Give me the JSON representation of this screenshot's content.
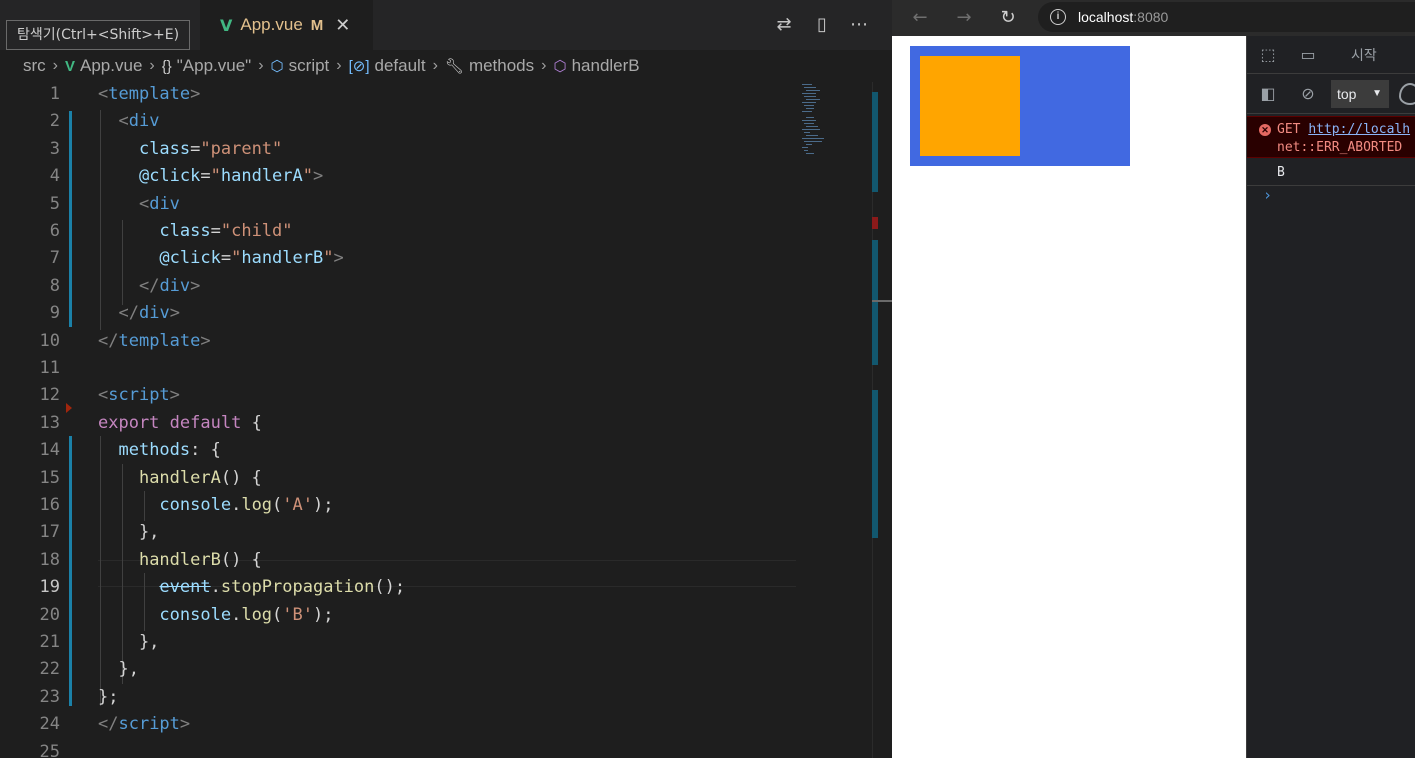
{
  "editor": {
    "tooltip": "탐색기(Ctrl+<Shift>+E)",
    "tab": {
      "filename": "App.vue",
      "modified": "M",
      "close": "✕"
    },
    "breadcrumb": [
      "src",
      "App.vue",
      "\"App.vue\"",
      "script",
      "default",
      "methods",
      "handlerB"
    ],
    "lines": [
      {
        "n": "1",
        "tokens": [
          [
            "t-punc",
            "<"
          ],
          [
            "t-tag",
            "template"
          ],
          [
            "t-punc",
            ">"
          ]
        ]
      },
      {
        "n": "2",
        "tokens": [
          [
            "t-plain",
            "  "
          ],
          [
            "t-punc",
            "<"
          ],
          [
            "t-tag",
            "div"
          ]
        ]
      },
      {
        "n": "3",
        "tokens": [
          [
            "t-plain",
            "    "
          ],
          [
            "t-attr",
            "class"
          ],
          [
            "t-plain",
            "="
          ],
          [
            "t-str",
            "\"parent\""
          ]
        ]
      },
      {
        "n": "4",
        "tokens": [
          [
            "t-plain",
            "    "
          ],
          [
            "t-attr",
            "@click"
          ],
          [
            "t-plain",
            "="
          ],
          [
            "t-str",
            "\""
          ],
          [
            "t-var",
            "handlerA"
          ],
          [
            "t-str",
            "\""
          ],
          [
            "t-punc",
            ">"
          ]
        ]
      },
      {
        "n": "5",
        "tokens": [
          [
            "t-plain",
            "    "
          ],
          [
            "t-punc",
            "<"
          ],
          [
            "t-tag",
            "div"
          ]
        ]
      },
      {
        "n": "6",
        "tokens": [
          [
            "t-plain",
            "      "
          ],
          [
            "t-attr",
            "class"
          ],
          [
            "t-plain",
            "="
          ],
          [
            "t-str",
            "\"child\""
          ]
        ]
      },
      {
        "n": "7",
        "tokens": [
          [
            "t-plain",
            "      "
          ],
          [
            "t-attr",
            "@click"
          ],
          [
            "t-plain",
            "="
          ],
          [
            "t-str",
            "\""
          ],
          [
            "t-var",
            "handlerB"
          ],
          [
            "t-str",
            "\""
          ],
          [
            "t-punc",
            ">"
          ]
        ]
      },
      {
        "n": "8",
        "tokens": [
          [
            "t-plain",
            "    "
          ],
          [
            "t-punc",
            "</"
          ],
          [
            "t-tag",
            "div"
          ],
          [
            "t-punc",
            ">"
          ]
        ]
      },
      {
        "n": "9",
        "tokens": [
          [
            "t-plain",
            "  "
          ],
          [
            "t-punc",
            "</"
          ],
          [
            "t-tag",
            "div"
          ],
          [
            "t-punc",
            ">"
          ]
        ]
      },
      {
        "n": "10",
        "tokens": [
          [
            "t-punc",
            "</"
          ],
          [
            "t-tag",
            "template"
          ],
          [
            "t-punc",
            ">"
          ]
        ]
      },
      {
        "n": "11",
        "tokens": []
      },
      {
        "n": "12",
        "tokens": [
          [
            "t-punc",
            "<"
          ],
          [
            "t-tag",
            "script"
          ],
          [
            "t-punc",
            ">"
          ]
        ]
      },
      {
        "n": "13",
        "tokens": [
          [
            "t-kw",
            "export"
          ],
          [
            "t-plain",
            " "
          ],
          [
            "t-kw",
            "default"
          ],
          [
            "t-plain",
            " {"
          ]
        ]
      },
      {
        "n": "14",
        "tokens": [
          [
            "t-plain",
            "  "
          ],
          [
            "t-var",
            "methods"
          ],
          [
            "t-plain",
            ": {"
          ]
        ]
      },
      {
        "n": "15",
        "tokens": [
          [
            "t-plain",
            "    "
          ],
          [
            "t-fn",
            "handlerA"
          ],
          [
            "t-plain",
            "() {"
          ]
        ]
      },
      {
        "n": "16",
        "tokens": [
          [
            "t-plain",
            "      "
          ],
          [
            "t-var",
            "console"
          ],
          [
            "t-plain",
            "."
          ],
          [
            "t-fn",
            "log"
          ],
          [
            "t-plain",
            "("
          ],
          [
            "t-str",
            "'A'"
          ],
          [
            "t-plain",
            ");"
          ]
        ]
      },
      {
        "n": "17",
        "tokens": [
          [
            "t-plain",
            "    },"
          ]
        ]
      },
      {
        "n": "18",
        "tokens": [
          [
            "t-plain",
            "    "
          ],
          [
            "t-fn",
            "handlerB"
          ],
          [
            "t-plain",
            "() {"
          ]
        ]
      },
      {
        "n": "19",
        "tokens": [
          [
            "t-plain",
            "      "
          ],
          [
            "t-dep",
            "event"
          ],
          [
            "t-plain",
            "."
          ],
          [
            "t-fn",
            "stopPropagation"
          ],
          [
            "t-plain",
            "();"
          ]
        ]
      },
      {
        "n": "20",
        "tokens": [
          [
            "t-plain",
            "      "
          ],
          [
            "t-var",
            "console"
          ],
          [
            "t-plain",
            "."
          ],
          [
            "t-fn",
            "log"
          ],
          [
            "t-plain",
            "("
          ],
          [
            "t-str",
            "'B'"
          ],
          [
            "t-plain",
            ");"
          ]
        ]
      },
      {
        "n": "21",
        "tokens": [
          [
            "t-plain",
            "    },"
          ]
        ]
      },
      {
        "n": "22",
        "tokens": [
          [
            "t-plain",
            "  },"
          ]
        ]
      },
      {
        "n": "23",
        "tokens": [
          [
            "t-plain",
            "};"
          ]
        ]
      },
      {
        "n": "24",
        "tokens": [
          [
            "t-punc",
            "</"
          ],
          [
            "t-tag",
            "script"
          ],
          [
            "t-punc",
            ">"
          ]
        ]
      },
      {
        "n": "25",
        "tokens": []
      }
    ],
    "current_line": "19"
  },
  "browser": {
    "url_host": "localhost",
    "url_port": ":8080",
    "parent_color": "#4169e1",
    "child_color": "#ffa500",
    "devtools": {
      "start_tab": "시작",
      "context": "top",
      "error_method": "GET",
      "error_url": "http://localh",
      "error_text": "net::ERR_ABORTED",
      "log_output": "B",
      "prompt": "›"
    }
  }
}
